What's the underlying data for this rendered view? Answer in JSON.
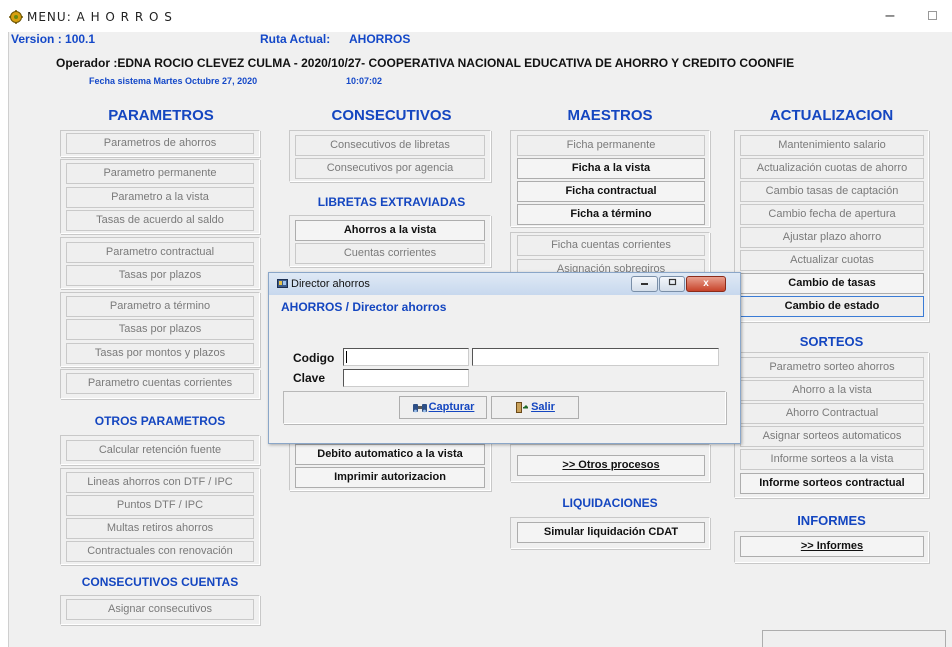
{
  "window": {
    "title": "MENU: A H O R R O S",
    "min_glyph": "–"
  },
  "header": {
    "version": "Version : 100.1",
    "route_label": "Ruta Actual:",
    "route_value": "AHORROS",
    "operator_line": "Operador :EDNA ROCIO CLEVEZ CULMA - 2020/10/27- COOPERATIVA NACIONAL EDUCATIVA DE AHORRO Y CREDITO COONFIE",
    "date_line": "Fecha sistema Martes Octubre 27, 2020",
    "time": "10:07:02"
  },
  "parametros": {
    "title": "PARAMETROS",
    "buttons": [
      "Parametros de ahorros",
      "Parametro permanente",
      "Parametro  a la vista",
      "Tasas de acuerdo al saldo",
      "Parametro  contractual",
      "Tasas por plazos",
      "Parametro  a término",
      "Tasas por plazos",
      "Tasas por montos y plazos",
      "Parametro  cuentas corrientes"
    ]
  },
  "otros_parametros": {
    "title": "OTROS PARAMETROS",
    "buttons": [
      "Calcular retención fuente",
      "Lineas ahorros con DTF / IPC",
      "Puntos  DTF / IPC",
      "Multas retiros ahorros",
      "Contractuales con renovación"
    ]
  },
  "consecutivos_cuentas": {
    "title": "CONSECUTIVOS CUENTAS",
    "buttons": [
      "Asignar consecutivos"
    ]
  },
  "consecutivos": {
    "title": "CONSECUTIVOS",
    "buttons": [
      "Consecutivos de libretas",
      "Consecutivos por agencia"
    ]
  },
  "libretas": {
    "title": "LIBRETAS EXTRAVIADAS",
    "buttons": [
      "Ahorros a la vista",
      "Cuentas corrientes",
      "Debito automatico  a la vista",
      "Imprimir autorizacion"
    ]
  },
  "maestros": {
    "title": "MAESTROS",
    "buttons": [
      "Ficha permanente",
      "Ficha a la vista",
      "Ficha contractual",
      "Ficha a término",
      "Ficha cuentas corrientes",
      "Asignación sobregiros",
      ">> Otros procesos"
    ]
  },
  "liquidaciones": {
    "title": "LIQUIDACIONES",
    "buttons": [
      "Simular liquidación CDAT"
    ]
  },
  "actualizacion": {
    "title": "ACTUALIZACION",
    "buttons": [
      "Mantenimiento salario",
      "Actualización cuotas de ahorro",
      "Cambio tasas de captación",
      "Cambio fecha de apertura",
      "Ajustar plazo ahorro",
      "Actualizar cuotas",
      "Cambio de tasas",
      "Cambio de estado"
    ]
  },
  "sorteos": {
    "title": "SORTEOS",
    "buttons": [
      "Parametro sorteo ahorros",
      "Ahorro a la vista",
      "Ahorro Contractual",
      "Asignar sorteos automaticos",
      "Informe sorteos a la vista",
      "Informe sorteos contractual"
    ]
  },
  "informes": {
    "title": "INFORMES",
    "buttons": [
      ">> Informes"
    ]
  },
  "dialog": {
    "title": "Director ahorros",
    "header": "AHORROS / Director ahorros",
    "codigo_label": "Codigo",
    "clave_label": "Clave",
    "codigo_value": "",
    "codigo_desc_value": "",
    "clave_value": "",
    "capturar_label": "Capturar",
    "salir_label": "Salir",
    "close_glyph": "x"
  },
  "colors": {
    "accent": "#1446c0",
    "background": "#f0f0f0"
  }
}
